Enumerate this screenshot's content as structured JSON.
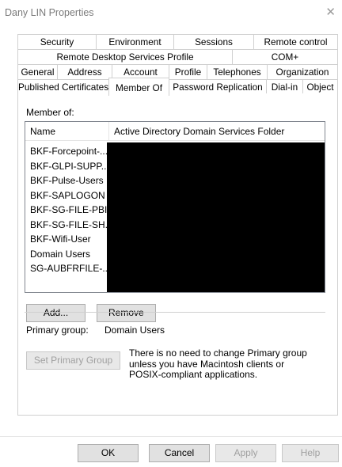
{
  "window": {
    "title": "Dany LIN Properties",
    "close_glyph": "✕"
  },
  "tabs": {
    "row1": [
      "Security",
      "Environment",
      "Sessions",
      "Remote control"
    ],
    "row2": [
      "Remote Desktop Services Profile",
      "COM+"
    ],
    "row3": [
      "General",
      "Address",
      "Account",
      "Profile",
      "Telephones",
      "Organization"
    ],
    "row4": [
      "Published Certificates",
      "Member Of",
      "Password Replication",
      "Dial-in",
      "Object"
    ],
    "active": "Member Of"
  },
  "member_of": {
    "label": "Member of:",
    "columns": [
      "Name",
      "Active Directory Domain Services Folder"
    ],
    "rows": [
      "BKF-Forcepoint-...",
      "BKF-GLPI-SUPP...",
      "BKF-Pulse-Users",
      "BKF-SAPLOGON",
      "BKF-SG-FILE-PBI...",
      "BKF-SG-FILE-SH...",
      "BKF-Wifi-User",
      "Domain Users",
      "SG-AUBFRFILE-..."
    ]
  },
  "actions": {
    "add": "Add...",
    "remove": "Remove"
  },
  "primary_group": {
    "label": "Primary group:",
    "value": "Domain Users",
    "set_button": "Set Primary Group",
    "note": "There is no need to change Primary group unless you have Macintosh clients or POSIX-compliant applications."
  },
  "footer": {
    "ok": "OK",
    "cancel": "Cancel",
    "apply": "Apply",
    "help": "Help"
  }
}
